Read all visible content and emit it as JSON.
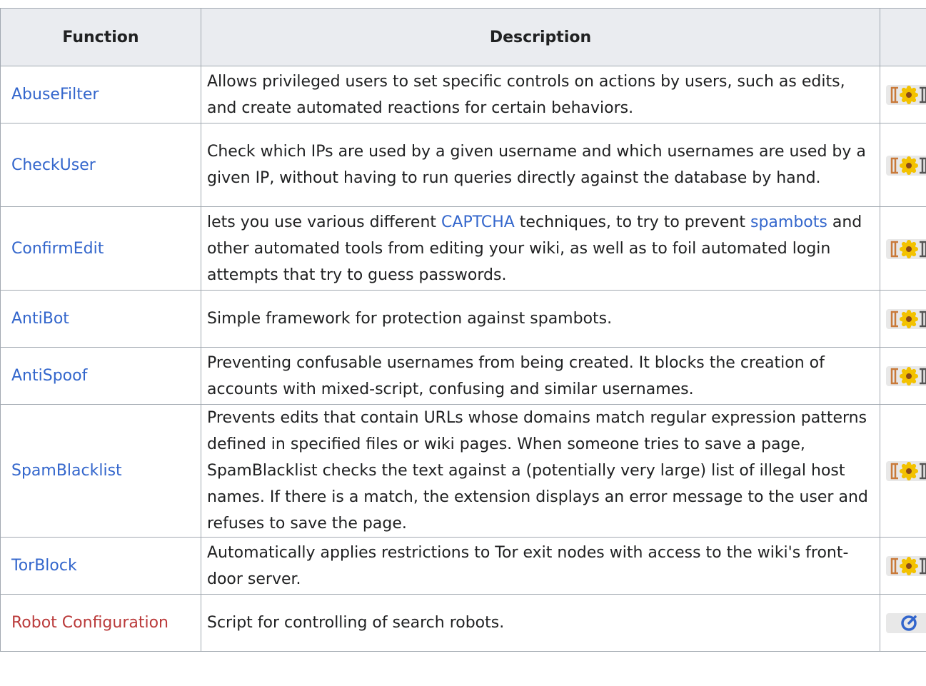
{
  "table": {
    "headers": [
      "Function",
      "Description",
      ""
    ],
    "rows": [
      {
        "function": "AbuseFilter",
        "link_color": "blue",
        "description": "Allows privileged users to set specific controls on actions by users, such as edits, and create automated reactions for certain behaviors.",
        "icon": "extension-icon"
      },
      {
        "function": "CheckUser",
        "link_color": "blue",
        "description": "Check which IPs are used by a given username and which usernames are used by a given IP, without having to run queries directly against the database by hand.",
        "icon": "extension-icon"
      },
      {
        "function": "ConfirmEdit",
        "link_color": "blue",
        "description_parts": [
          {
            "text": "lets you use various different ",
            "link": false
          },
          {
            "text": "CAPTCHA",
            "link": true
          },
          {
            "text": " techniques, to try to prevent ",
            "link": false
          },
          {
            "text": "spambots",
            "link": true
          },
          {
            "text": " and other automated tools from editing your wiki, as well as to foil automated login attempts that try to guess passwords.",
            "link": false
          }
        ],
        "icon": "extension-icon"
      },
      {
        "function": "AntiBot",
        "link_color": "blue",
        "description": "Simple framework for protection against spambots.",
        "icon": "extension-icon"
      },
      {
        "function": "AntiSpoof",
        "link_color": "blue",
        "description": "Preventing confusable usernames from being created. It blocks the creation of accounts with mixed-script, confusing and similar usernames.",
        "icon": "extension-icon"
      },
      {
        "function": "SpamBlacklist",
        "link_color": "blue",
        "description": "Prevents edits that contain URLs whose domains match regular expression patterns defined in specified files or wiki pages. When someone tries to save a page, SpamBlacklist checks the text against a (potentially very large) list of illegal host names. If there is a match, the extension displays an error message to the user and refuses to save the page.",
        "icon": "extension-icon"
      },
      {
        "function": "TorBlock",
        "link_color": "blue",
        "description": "Automatically applies restrictions to Tor exit nodes with access to the wiki's front-door server.",
        "icon": "extension-icon"
      },
      {
        "function": "Robot Configuration",
        "link_color": "red",
        "description": "Script for controlling of search robots.",
        "icon": "gauge-icon"
      }
    ]
  },
  "colors": {
    "link": "#3366cc",
    "new_link": "#ba3a3a",
    "header_bg": "#eaecf0",
    "border": "#a2a9b1",
    "text": "#202122"
  }
}
